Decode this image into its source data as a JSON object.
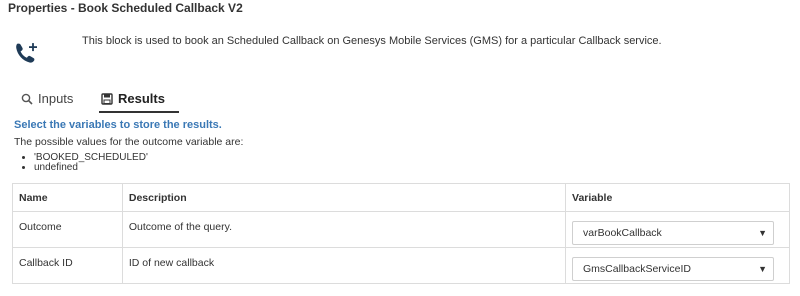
{
  "header": {
    "title": "Properties - Book Scheduled Callback V2"
  },
  "block": {
    "icon": "phone-callback-plus-icon",
    "description": "This block is used to book an Scheduled Callback on Genesys Mobile Services (GMS) for a particular Callback service."
  },
  "tabs": [
    {
      "label": "Inputs",
      "icon": "search-icon",
      "active": false
    },
    {
      "label": "Results",
      "icon": "save-icon",
      "active": true
    }
  ],
  "results": {
    "heading": "Select the variables to store the results.",
    "outcome_note": "The possible values for the outcome variable are:",
    "outcome_values": [
      "'BOOKED_SCHEDULED'",
      "undefined"
    ],
    "accent_color": "#3a78b5",
    "columns": {
      "name": "Name",
      "description": "Description",
      "variable": "Variable"
    },
    "rows": [
      {
        "name": "Outcome",
        "description": "Outcome of the query.",
        "variable": "varBookCallback"
      },
      {
        "name": "Callback ID",
        "description": "ID of new callback",
        "variable": "GmsCallbackServiceID"
      }
    ]
  }
}
